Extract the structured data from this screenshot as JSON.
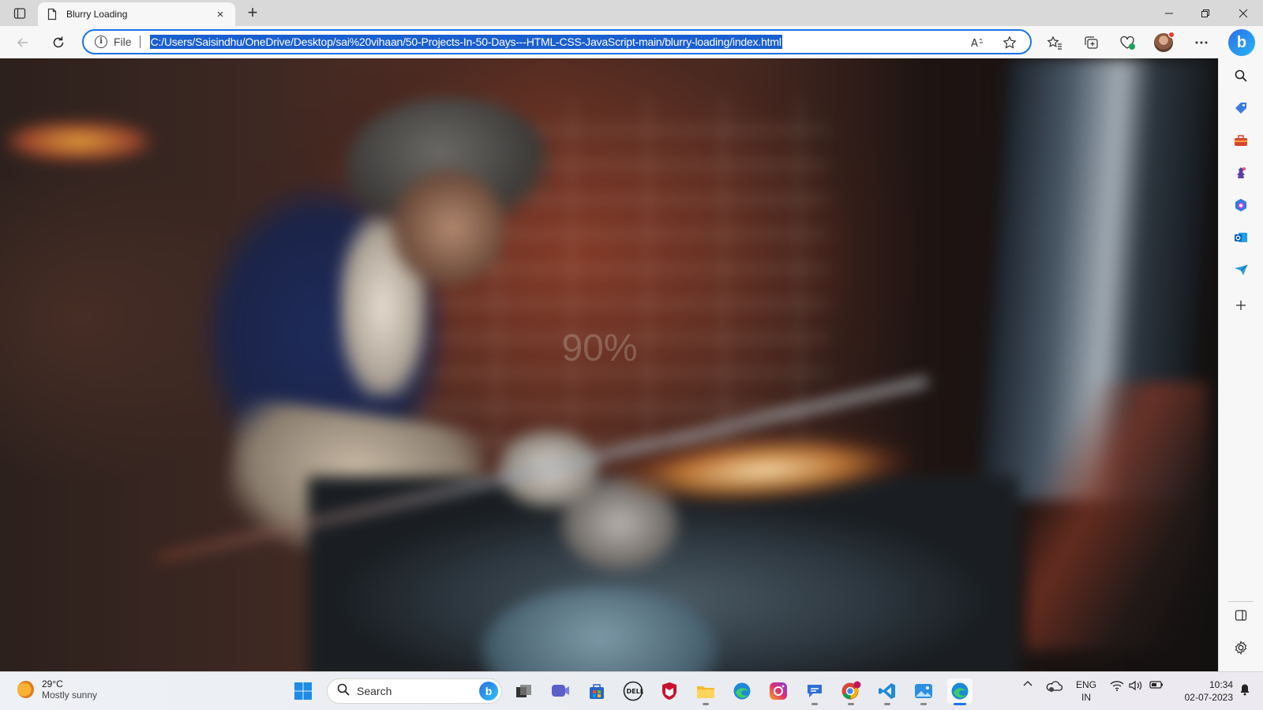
{
  "browser": {
    "tab_title": "Blurry Loading",
    "tab_close": "×",
    "new_tab": "+",
    "scheme_label": "File",
    "url": "C:/Users/Saisindhu/OneDrive/Desktop/sai%20vihaan/50-Projects-In-50-Days---HTML-CSS-JavaScript-main/blurry-loading/index.html",
    "accent_color": "#1a73e8",
    "icons": [
      "tab-actions-icon",
      "page-icon",
      "back-icon",
      "refresh-icon",
      "info-icon",
      "read-aloud-icon",
      "favorite-star-icon",
      "favorites-icon",
      "collections-icon",
      "browser-essentials-icon",
      "profile-avatar",
      "more-icon",
      "copilot-icon",
      "minimize-icon",
      "restore-icon",
      "close-icon"
    ]
  },
  "page": {
    "loading_text": "90%",
    "loading_opacity": 0.2
  },
  "sidebar": {
    "icons": [
      "search-icon",
      "shopping-icon",
      "tools-icon",
      "games-icon",
      "microsoft365-icon",
      "outlook-icon",
      "drop-icon",
      "add-icon",
      "split-screen-icon",
      "settings-icon"
    ]
  },
  "taskbar": {
    "weather_temp": "29°C",
    "weather_condition": "Mostly sunny",
    "search_placeholder": "Search",
    "apps": [
      "start-icon",
      "task-view-icon",
      "teams-icon",
      "store-icon",
      "dell-icon",
      "mcafee-icon",
      "file-explorer-icon",
      "edge-icon",
      "instagram-icon",
      "chat-icon",
      "chrome-icon",
      "vscode-icon",
      "photos-icon",
      "edge-active-icon"
    ],
    "language_line1": "ENG",
    "language_line2": "IN",
    "time": "10:34",
    "date": "02-07-2023"
  }
}
